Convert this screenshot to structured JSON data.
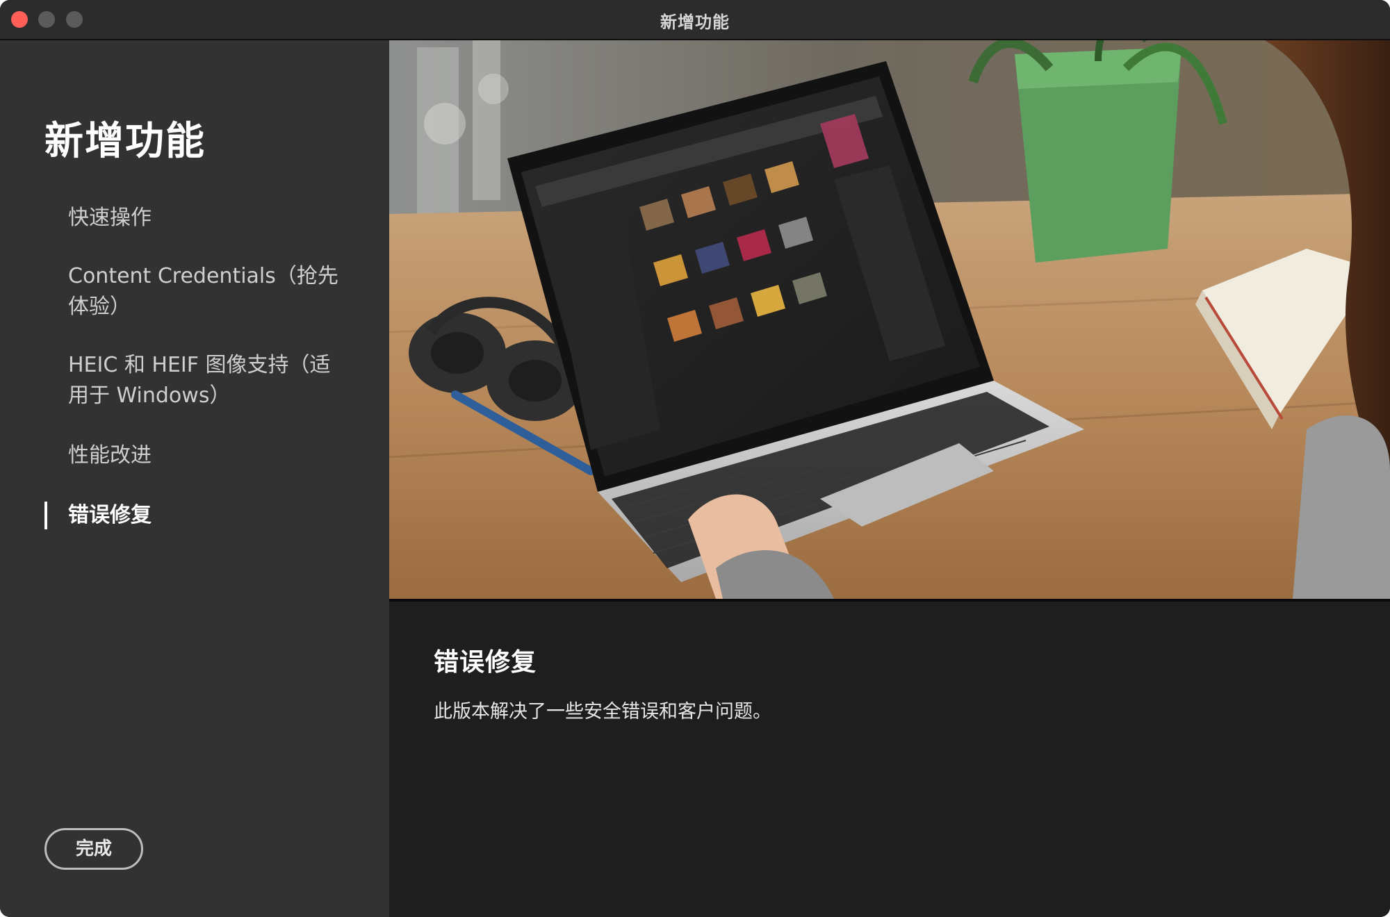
{
  "window": {
    "title": "新增功能"
  },
  "sidebar": {
    "heading": "新增功能",
    "items": [
      {
        "label": "快速操作"
      },
      {
        "label": "Content Credentials（抢先体验）"
      },
      {
        "label": "HEIC 和 HEIF 图像支持（适用于 Windows）"
      },
      {
        "label": "性能改进"
      },
      {
        "label": "错误修复"
      }
    ],
    "active_index": 4,
    "done_label": "完成"
  },
  "main": {
    "hero_image": "photo-of-person-using-laptop-with-photo-app",
    "feature_title": "错误修复",
    "feature_description": "此版本解决了一些安全错误和客户问题。"
  },
  "colors": {
    "close": "#ff5f57",
    "sidebar_bg": "#323232",
    "main_bg": "#1e1e1e"
  }
}
